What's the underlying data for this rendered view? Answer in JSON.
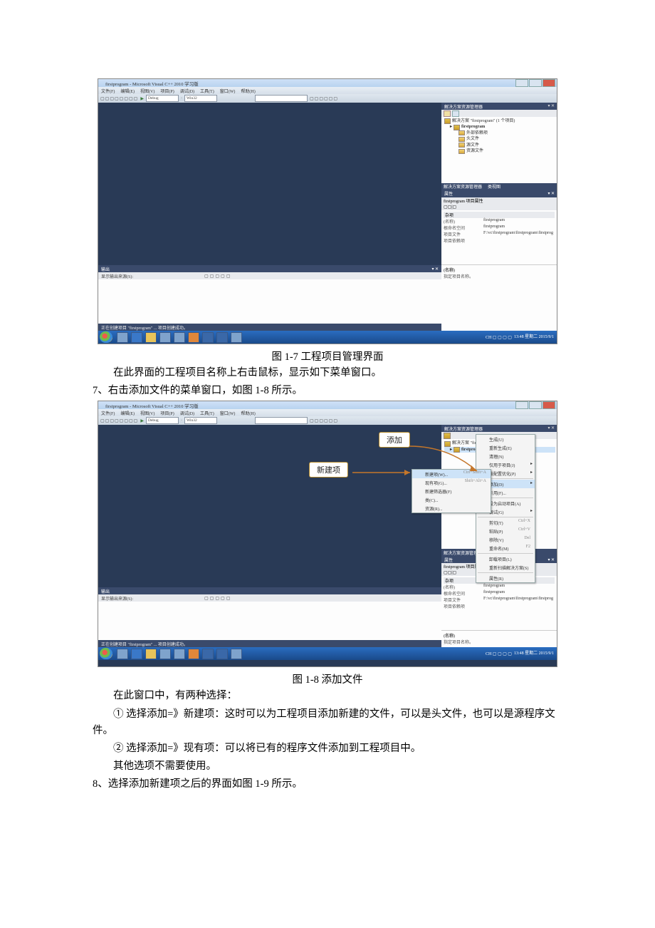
{
  "ide": {
    "title": "firstprogram - Microsoft Visual C++ 2010 学习版",
    "menu": [
      "文件(F)",
      "编辑(E)",
      "视图(V)",
      "项目(P)",
      "调试(D)",
      "工具(T)",
      "窗口(W)",
      "帮助(H)"
    ],
    "toolbar": {
      "config": "Debug",
      "platform": "Win32"
    },
    "solution_panel": {
      "title": "解决方案资源管理器",
      "solution": "解决方案 \"firstprogram\" (1 个项目)",
      "project": "firstprogram",
      "folders": [
        "外部依赖项",
        "头文件",
        "源文件",
        "资源文件"
      ]
    },
    "tabstrip": {
      "a": "解决方案资源管理器",
      "b": "类视图"
    },
    "props": {
      "title": "属性",
      "sub": "firstprogram 项目属性",
      "cat": "杂项",
      "rows": [
        {
          "k": "(名称)",
          "v": "firstprogram"
        },
        {
          "k": "根命名空间",
          "v": "firstprogram"
        },
        {
          "k": "项目文件",
          "v": "F:\\vc\\firstprogram\\firstprogram\\firstprog"
        },
        {
          "k": "项目依赖项",
          "v": ""
        }
      ],
      "desc_t": "(名称)",
      "desc_b": "指定项目名称。"
    },
    "output": {
      "title": "输出",
      "label": "显示输出来源(S):"
    },
    "status": "正在创建项目 \"firstprogram\" ... 项目创建成功。",
    "taskbar": {
      "clock": "13:48 星期二\n2015/9/1"
    }
  },
  "ctx1": {
    "items": [
      {
        "t": "生成(U)"
      },
      {
        "t": "重新生成(E)"
      },
      {
        "t": "清理(N)"
      },
      {
        "t": "仅用于项目(J)",
        "arrow": true
      },
      {
        "t": "按配置优化(P)",
        "arrow": true
      },
      {
        "sep": true
      },
      {
        "t": "添加(D)",
        "arrow": true,
        "hi": true
      },
      {
        "t": "引用(F)..."
      },
      {
        "sep": true
      },
      {
        "t": "设为启动项目(A)"
      },
      {
        "t": "调试(G)",
        "arrow": true
      },
      {
        "sep": true
      },
      {
        "t": "剪切(T)",
        "sc": "Ctrl+X"
      },
      {
        "t": "粘贴(P)",
        "sc": "Ctrl+V"
      },
      {
        "t": "移除(V)",
        "sc": "Del"
      },
      {
        "t": "重命名(M)",
        "sc": "F2"
      },
      {
        "sep": true
      },
      {
        "t": "卸载项目(L)"
      },
      {
        "t": "重新扫描解决方案(S)"
      },
      {
        "sep": true
      },
      {
        "t": "属性(R)"
      }
    ]
  },
  "ctx2": {
    "items": [
      {
        "t": "新建项(W)...",
        "sc": "Ctrl+Shift+A",
        "hi": true
      },
      {
        "t": "现有项(G)...",
        "sc": "Shift+Alt+A"
      },
      {
        "t": "新建筛选器(F)"
      },
      {
        "t": "类(C)..."
      },
      {
        "t": "资源(R)..."
      }
    ]
  },
  "callouts": {
    "add": "添加",
    "newitem": "新建项"
  },
  "text": {
    "cap1": "图 1-7    工程项目管理界面",
    "p1": "在此界面的工程项目名称上右击鼠标，显示如下菜单窗口。",
    "n7": "7、右击添加文件的菜单窗口，如图 1-8 所示。",
    "cap2": "图 1-8  添加文件",
    "p2": "在此窗口中，有两种选择：",
    "p3": "① 选择添加=》新建项：这时可以为工程项目添加新建的文件，可以是头文件，也可以是源程序文件。",
    "p4": "② 选择添加=》现有项：可以将已有的程序文件添加到工程项目中。",
    "p5": "其他选项不需要使用。",
    "n8": "8、选择添加新建项之后的界面如图 1-9 所示。"
  }
}
